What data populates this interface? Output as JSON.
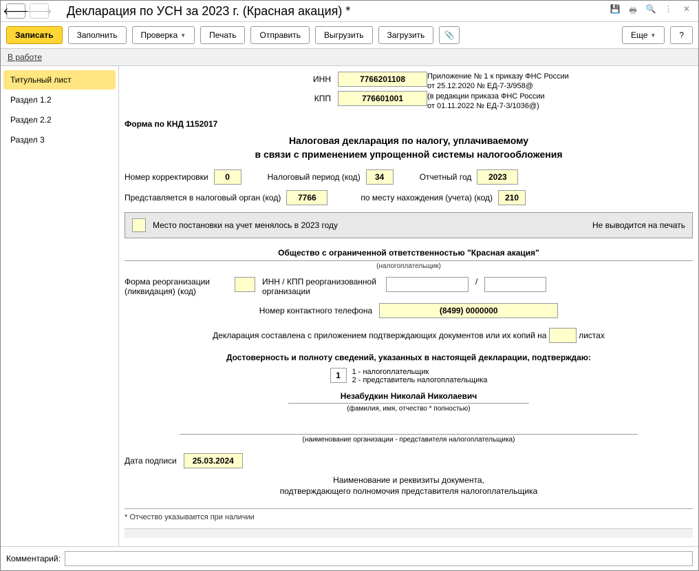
{
  "window": {
    "title": "Декларация по УСН за 2023 г. (Красная акация) *"
  },
  "toolbar": {
    "save": "Записать",
    "fill": "Заполнить",
    "check": "Проверка",
    "print": "Печать",
    "send": "Отправить",
    "upload": "Выгрузить",
    "download": "Загрузить",
    "more": "Еще",
    "help": "?"
  },
  "status": {
    "text": "В работе"
  },
  "sidebar": {
    "items": [
      {
        "label": "Титульный лист"
      },
      {
        "label": "Раздел 1.2"
      },
      {
        "label": "Раздел 2.2"
      },
      {
        "label": "Раздел 3"
      }
    ]
  },
  "header": {
    "inn_label": "ИНН",
    "inn": "7766201108",
    "kpp_label": "КПП",
    "kpp": "776601001",
    "right_lines": [
      "Приложение № 1 к приказу ФНС России",
      "от 25.12.2020 № ЕД-7-3/958@",
      "(в редакции приказа ФНС России",
      "от 01.11.2022 № ЕД-7-3/1036@)"
    ]
  },
  "form_code": "Форма по КНД 1152017",
  "main_title_1": "Налоговая декларация по налогу, уплачиваемому",
  "main_title_2": "в связи с применением упрощенной системы налогообложения",
  "row1": {
    "corr_label": "Номер корректировки",
    "corr": "0",
    "period_label": "Налоговый период (код)",
    "period": "34",
    "year_label": "Отчетный год",
    "year": "2023"
  },
  "row2": {
    "organ_label": "Представляется в налоговый орган (код)",
    "organ": "7766",
    "place_label": "по месту нахождения (учета) (код)",
    "place": "210"
  },
  "strip": {
    "text": "Место постановки на учет менялось в 2023 году",
    "right": "Не выводится на печать"
  },
  "org": {
    "name": "Общество с ограниченной ответственностью \"Красная акация\"",
    "sub": "(налогоплательщик)"
  },
  "reorg": {
    "label_left": "Форма реорганизации (ликвидация) (код)",
    "label_mid": "ИНН / КПП реорганизованной организации"
  },
  "phone": {
    "label": "Номер контактного телефона",
    "value": "(8499) 0000000"
  },
  "docs": {
    "before": "Декларация составлена с приложением подтверждающих документов или их копий на",
    "after": "листах"
  },
  "confirm": {
    "title": "Достоверность и полноту сведений, указанных в настоящей декларации, подтверждаю:",
    "code": "1",
    "legend1": "1 - налогоплательщик",
    "legend2": "2 - представитель налогоплательщика"
  },
  "fio": {
    "name": "Незабудкин Николай Николаевич",
    "sub": "(фамилия, имя, отчество * полностью)"
  },
  "rep_org_sub": "(наименование организации - представителя налогоплательщика)",
  "sign": {
    "label": "Дата подписи",
    "date": "25.03.2024"
  },
  "footer": {
    "line1": "Наименование и реквизиты документа,",
    "line2": "подтверждающего полномочия представителя налогоплательщика"
  },
  "footnote": "*  Отчество указывается при наличии",
  "comment": {
    "label": "Комментарий:"
  }
}
